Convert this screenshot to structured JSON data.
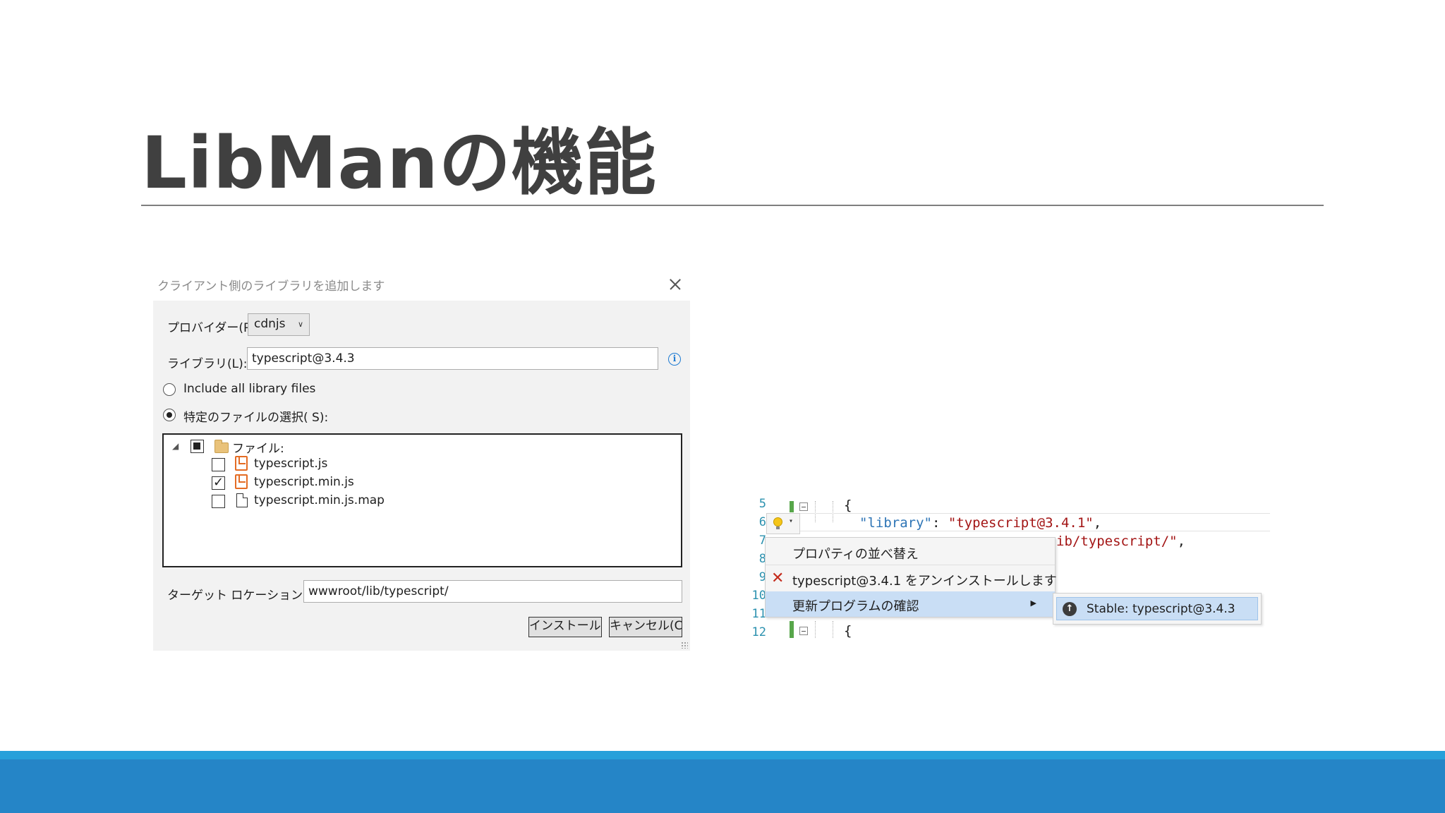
{
  "slide": {
    "title": "LibManの機能",
    "colors": {
      "title": "#404040",
      "footer_band": "#2585c7",
      "footer_top": "#26a0da"
    }
  },
  "dialog": {
    "title": "クライアント側のライブラリを追加します",
    "provider_label": "プロバイダー(P",
    "provider_value": "cdnjs",
    "library_label": "ライブラリ(L):",
    "library_value": "typescript@3.4.3",
    "radio_all_label": "Include all library files",
    "radio_specific_label": "特定のファイルの選択( S):",
    "tree": {
      "folder_label": "ファイル:",
      "files": [
        {
          "name": "typescript.js",
          "checked": false,
          "icon": "js-file-icon"
        },
        {
          "name": "typescript.min.js",
          "checked": true,
          "icon": "js-file-icon"
        },
        {
          "name": "typescript.min.js.map",
          "checked": false,
          "icon": "document-icon"
        }
      ]
    },
    "target_label": "ターゲット ロケーション(T):",
    "target_value": "wwwroot/lib/typescript/",
    "install_button": "インストール(I",
    "cancel_button": "キャンセル(C)"
  },
  "editor": {
    "line_numbers": [
      "5",
      "6",
      "7",
      "8",
      "9",
      "10",
      "11",
      "12"
    ],
    "line5": "{",
    "line6_key": "\"library\"",
    "line6_colon": ": ",
    "line6_value": "\"typescript@3.4.1\"",
    "line6_comma": ",",
    "line7_value": "ib/typescript/\"",
    "line7_comma": ",",
    "line12": "{",
    "menu": {
      "sort_properties": "プロパティの並べ替え",
      "uninstall": "typescript@3.4.1 をアンインストールします",
      "check_updates": "更新プログラムの確認",
      "submenu_stable": "Stable: typescript@3.4.3"
    }
  }
}
